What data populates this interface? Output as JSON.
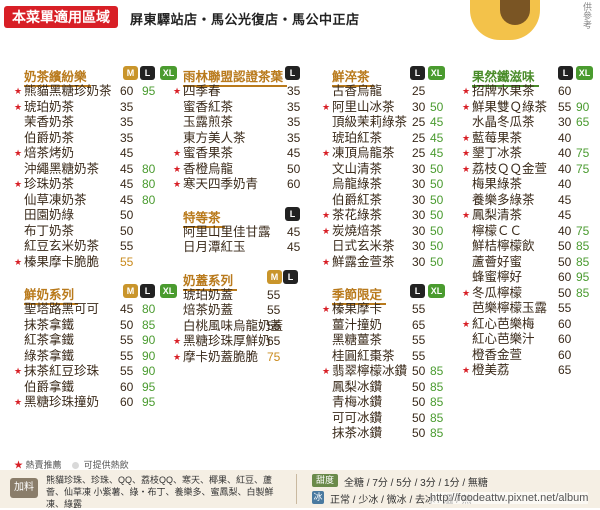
{
  "header": {
    "area_tag": "本菜單適用區域",
    "stores": "屏東驛站店・馬公光復店・馬公中正店",
    "side_note": "供參考"
  },
  "sizes": {
    "m": "M",
    "l": "L",
    "xl": "XL"
  },
  "columns": [
    {
      "categories": [
        {
          "title": "奶茶繽紛樂",
          "title_color": "orange",
          "sizes": [
            "m",
            "l",
            "xl"
          ],
          "items": [
            {
              "star": true,
              "name": "熊貓黑糖珍奶茶",
              "p1": "60",
              "p2": "95"
            },
            {
              "star": true,
              "name": "琥珀奶茶",
              "p1": "35",
              "p2": ""
            },
            {
              "star": false,
              "name": "茉香奶茶",
              "p1": "35",
              "p2": ""
            },
            {
              "star": false,
              "name": "伯爵奶茶",
              "p1": "35",
              "p2": ""
            },
            {
              "star": true,
              "name": "焙茶烤奶",
              "p1": "45",
              "p2": ""
            },
            {
              "star": false,
              "name": "沖繩黑糖奶茶",
              "p1": "45",
              "p2": "80"
            },
            {
              "star": true,
              "name": "珍珠奶茶",
              "p1": "45",
              "p2": "80"
            },
            {
              "star": false,
              "name": "仙草凍奶茶",
              "p1": "45",
              "p2": "80"
            },
            {
              "star": false,
              "name": "田園奶綠",
              "p1": "50",
              "p2": ""
            },
            {
              "star": false,
              "name": "布丁奶茶",
              "p1": "50",
              "p2": ""
            },
            {
              "star": false,
              "name": "紅豆玄米奶茶",
              "p1": "55",
              "p2": ""
            },
            {
              "star": true,
              "name": "榛果摩卡脆脆",
              "p1": "55",
              "p2": "",
              "p1_orange": true
            }
          ]
        },
        {
          "title": "鮮奶系列",
          "title_color": "orange",
          "sizes": [
            "m",
            "l",
            "xl"
          ],
          "items": [
            {
              "star": false,
              "name": "聖塔路黑可可",
              "p1": "45",
              "p2": "80"
            },
            {
              "star": false,
              "name": "抹茶拿鐵",
              "p1": "50",
              "p2": "85"
            },
            {
              "star": false,
              "name": "紅茶拿鐵",
              "p1": "55",
              "p2": "90"
            },
            {
              "star": false,
              "name": "綠茶拿鐵",
              "p1": "55",
              "p2": "90"
            },
            {
              "star": true,
              "name": "抹茶紅豆珍珠",
              "p1": "55",
              "p2": "90"
            },
            {
              "star": false,
              "name": "伯爵拿鐵",
              "p1": "60",
              "p2": "95"
            },
            {
              "star": true,
              "name": "黑糖珍珠撞奶",
              "p1": "60",
              "p2": "95"
            }
          ]
        }
      ]
    },
    {
      "categories": [
        {
          "title": "雨林聯盟認證茶葉",
          "title_color": "orange",
          "sizes": [
            "l"
          ],
          "items": [
            {
              "star": true,
              "name": "四季春",
              "p1": "35",
              "p2": ""
            },
            {
              "star": false,
              "name": "蜜香紅茶",
              "p1": "35",
              "p2": ""
            },
            {
              "star": false,
              "name": "玉露煎茶",
              "p1": "35",
              "p2": ""
            },
            {
              "star": false,
              "name": "東方美人茶",
              "p1": "35",
              "p2": ""
            },
            {
              "star": true,
              "name": "蜜香果茶",
              "p1": "45",
              "p2": ""
            },
            {
              "star": true,
              "name": "香橙烏龍",
              "p1": "50",
              "p2": ""
            },
            {
              "star": true,
              "name": "寒天四季奶青",
              "p1": "60",
              "p2": ""
            }
          ]
        },
        {
          "title": "特等茶",
          "title_color": "orange",
          "sizes": [
            "l"
          ],
          "items": [
            {
              "star": false,
              "name": "阿里山里佳甘露",
              "p1": "45",
              "p2": ""
            },
            {
              "star": false,
              "name": "日月潭紅玉",
              "p1": "45",
              "p2": ""
            }
          ]
        },
        {
          "title": "奶蓋系列",
          "title_color": "orange",
          "sizes": [
            "m",
            "l"
          ],
          "items": [
            {
              "star": false,
              "name": "琥珀奶蓋",
              "p1": "55",
              "p2": ""
            },
            {
              "star": false,
              "name": "焙茶奶蓋",
              "p1": "55",
              "p2": ""
            },
            {
              "star": false,
              "name": "白桃風味烏龍奶蓋",
              "p1": "55",
              "p2": ""
            },
            {
              "star": true,
              "name": "黑糖珍珠厚鮮奶",
              "p1": "65",
              "p2": ""
            },
            {
              "star": true,
              "name": "摩卡奶蓋脆脆",
              "p1": "75",
              "p2": "",
              "p1_orange": true
            }
          ]
        }
      ]
    },
    {
      "categories": [
        {
          "title": "鮮淬茶",
          "title_color": "orange",
          "sizes": [
            "l",
            "xl"
          ],
          "items": [
            {
              "star": false,
              "name": "古香烏龍",
              "p1": "25",
              "p2": ""
            },
            {
              "star": true,
              "name": "阿里山冰茶",
              "p1": "30",
              "p2": "50"
            },
            {
              "star": false,
              "name": "頂級茉莉綠茶",
              "p1": "25",
              "p2": "45"
            },
            {
              "star": false,
              "name": "琥珀紅茶",
              "p1": "25",
              "p2": "45"
            },
            {
              "star": true,
              "name": "凍頂烏龍茶",
              "p1": "25",
              "p2": "45"
            },
            {
              "star": false,
              "name": "文山清茶",
              "p1": "30",
              "p2": "50"
            },
            {
              "star": false,
              "name": "烏龍綠茶",
              "p1": "30",
              "p2": "50"
            },
            {
              "star": false,
              "name": "伯爵紅茶",
              "p1": "30",
              "p2": "50"
            },
            {
              "star": true,
              "name": "茶花綠茶",
              "p1": "30",
              "p2": "50"
            },
            {
              "star": true,
              "name": "炭燒焙茶",
              "p1": "30",
              "p2": "50"
            },
            {
              "star": false,
              "name": "日式玄米茶",
              "p1": "30",
              "p2": "50"
            },
            {
              "star": true,
              "name": "鮮露金萱茶",
              "p1": "30",
              "p2": "50"
            }
          ]
        },
        {
          "title": "季節限定",
          "title_color": "orange",
          "sizes": [
            "l",
            "xl"
          ],
          "items": [
            {
              "star": true,
              "name": "榛果摩卡",
              "p1": "55",
              "p2": ""
            },
            {
              "star": false,
              "name": "薑汁撞奶",
              "p1": "65",
              "p2": ""
            },
            {
              "star": false,
              "name": "黑糖薑茶",
              "p1": "55",
              "p2": ""
            },
            {
              "star": false,
              "name": "桂圓紅棗茶",
              "p1": "55",
              "p2": ""
            },
            {
              "star": true,
              "name": "翡翠檸檬冰鑽",
              "p1": "50",
              "p2": "85"
            },
            {
              "star": false,
              "name": "鳳梨冰鑽",
              "p1": "50",
              "p2": "85"
            },
            {
              "star": false,
              "name": "青梅冰鑽",
              "p1": "50",
              "p2": "85"
            },
            {
              "star": false,
              "name": "可可冰鑽",
              "p1": "50",
              "p2": "85"
            },
            {
              "star": false,
              "name": "抹茶冰鑽",
              "p1": "50",
              "p2": "85"
            }
          ]
        }
      ]
    },
    {
      "categories": [
        {
          "title": "果然鐵滋味",
          "title_color": "green",
          "sizes": [
            "l",
            "xl"
          ],
          "items": [
            {
              "star": true,
              "name": "招牌水果茶",
              "p1": "60",
              "p2": ""
            },
            {
              "star": true,
              "name": "鮮果雙Ｑ綠茶",
              "p1": "55",
              "p2": "90"
            },
            {
              "star": false,
              "name": "水晶冬瓜茶",
              "p1": "30",
              "p2": "65"
            },
            {
              "star": true,
              "name": "藍莓果茶",
              "p1": "40",
              "p2": ""
            },
            {
              "star": true,
              "name": "墾丁冰茶",
              "p1": "40",
              "p2": "75"
            },
            {
              "star": true,
              "name": "荔枝ＱＱ金萱",
              "p1": "40",
              "p2": "75"
            },
            {
              "star": false,
              "name": "梅果綠茶",
              "p1": "40",
              "p2": ""
            },
            {
              "star": false,
              "name": "養樂多綠茶",
              "p1": "45",
              "p2": ""
            },
            {
              "star": true,
              "name": "鳳梨清茶",
              "p1": "45",
              "p2": ""
            },
            {
              "star": false,
              "name": "檸檬ＣＣ",
              "p1": "40",
              "p2": "75"
            },
            {
              "star": false,
              "name": "鮮桔檸檬飲",
              "p1": "50",
              "p2": "85"
            },
            {
              "star": false,
              "name": "蘆薈好蜜",
              "p1": "50",
              "p2": "85"
            },
            {
              "star": false,
              "name": "蜂蜜檸好",
              "p1": "60",
              "p2": "95"
            },
            {
              "star": true,
              "name": "冬瓜檸檬",
              "p1": "50",
              "p2": "85"
            },
            {
              "star": false,
              "name": "芭樂檸檬玉露",
              "p1": "55",
              "p2": ""
            },
            {
              "star": true,
              "name": "紅心芭樂梅",
              "p1": "60",
              "p2": ""
            },
            {
              "star": false,
              "name": "紅心芭樂汁",
              "p1": "60",
              "p2": ""
            },
            {
              "star": false,
              "name": "橙香金萱",
              "p1": "60",
              "p2": ""
            },
            {
              "star": true,
              "name": "橙美荔",
              "p1": "65",
              "p2": ""
            }
          ]
        }
      ]
    }
  ],
  "legend": {
    "star_label": "熱賣推薦",
    "hot_label": "可提供熱飲"
  },
  "bottom": {
    "addon_tag": "加料",
    "addon_text": "熊貓珍珠、珍珠、QQ、荔枝QQ、寒天、椰果、紅豆、蘆薈、仙草凍 小紫薯、綠・布丁、養樂多、蜜鳳梨、白製鮮凍、綠露",
    "sweet_tag": "甜度",
    "sweet_text": "全糖 / 7分 / 5分 / 3分 / 1分 / 無糖",
    "ice_tag": "冰",
    "ice_text": "正常 / 少冰 / 微冰 / 去冰 / 溫 / 熱",
    "watermark": "http://foodeattw.pixnet.net/album"
  },
  "colors": {
    "area_red": "#d81f26",
    "title_orange": "#b97a1c",
    "title_green": "#4a8c2a",
    "price_green": "#4a9b2f",
    "size_m": "#c9952b",
    "size_l": "#222222",
    "size_xl": "#4a9b2f"
  }
}
